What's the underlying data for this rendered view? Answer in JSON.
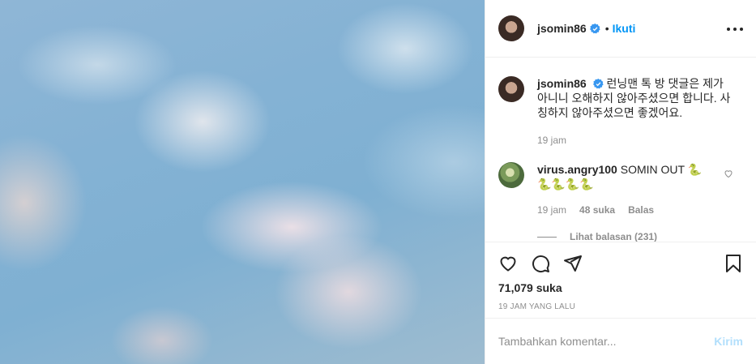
{
  "post": {
    "username": "jsomin86",
    "follow_label": "Ikuti",
    "dot": "•"
  },
  "caption": {
    "username": "jsomin86",
    "text": "런닝맨 톡 방 댓글은 제가 아니니 오해하지 않아주셨으면 합니다. 사칭하지 않아주셨으면 좋겠어요.",
    "time": "19 jam"
  },
  "comment": {
    "username": "virus.angry100",
    "text": "SOMIN OUT 🐍",
    "emoji_line": "🐍🐍🐍🐍",
    "time": "19 jam",
    "likes": "48 suka",
    "reply_label": "Balas",
    "view_replies": "Lihat balasan (231)"
  },
  "stats": {
    "likes": "71,079 suka",
    "posted": "19 JAM YANG LALU"
  },
  "add_comment": {
    "placeholder": "Tambahkan komentar...",
    "post_label": "Kirim"
  },
  "colors": {
    "accent": "#0095f6",
    "post_disabled": "#b2dffc",
    "muted": "#8e8e8e",
    "text": "#262626"
  },
  "icons": [
    "verified-badge-icon",
    "more-options-icon",
    "heart-icon",
    "comment-icon",
    "share-icon",
    "bookmark-icon"
  ]
}
